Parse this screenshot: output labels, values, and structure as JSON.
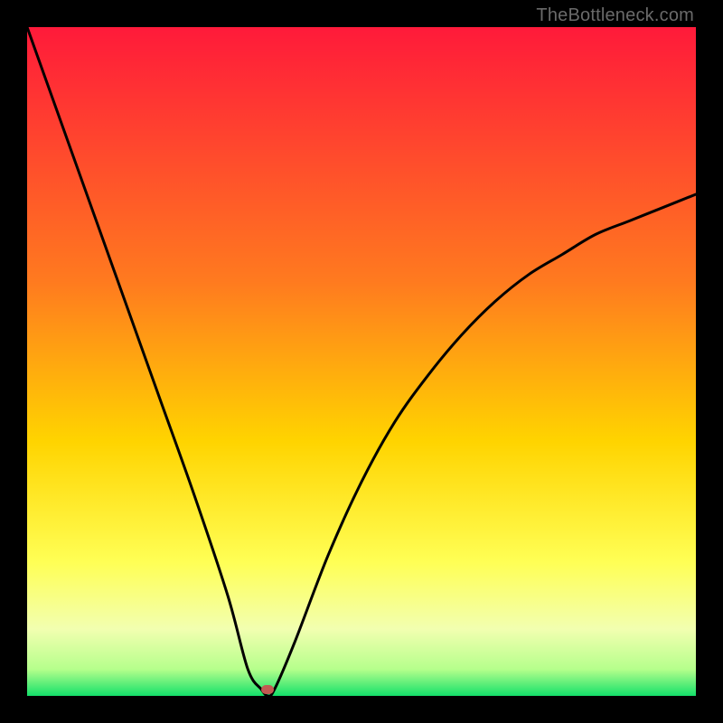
{
  "watermark": "TheBottleneck.com",
  "colors": {
    "frame": "#000000",
    "top": "#ff1a3a",
    "mid_upper": "#ff7a1f",
    "mid": "#ffd400",
    "mid_lower": "#ffff66",
    "pale": "#e9ffb3",
    "bottom": "#14e06a",
    "curve": "#000000",
    "marker": "#c25a52"
  },
  "chart_data": {
    "type": "line",
    "title": "",
    "xlabel": "",
    "ylabel": "",
    "xlim": [
      0,
      100
    ],
    "ylim": [
      0,
      100
    ],
    "annotations": [
      {
        "text": "TheBottleneck.com",
        "pos": "top-right"
      }
    ],
    "series": [
      {
        "name": "bottleneck-curve",
        "x": [
          0,
          5,
          10,
          15,
          20,
          25,
          30,
          33,
          35,
          36,
          37,
          40,
          45,
          50,
          55,
          60,
          65,
          70,
          75,
          80,
          85,
          90,
          95,
          100
        ],
        "y": [
          100,
          86,
          72,
          58,
          44,
          30,
          15,
          4,
          1,
          0,
          1,
          8,
          21,
          32,
          41,
          48,
          54,
          59,
          63,
          66,
          69,
          71,
          73,
          75
        ]
      }
    ],
    "markers": [
      {
        "name": "optimal-point",
        "x": 36,
        "y": 1
      }
    ],
    "gradient_stops": [
      {
        "pct": 0,
        "color": "#ff1a3a"
      },
      {
        "pct": 38,
        "color": "#ff7a1f"
      },
      {
        "pct": 62,
        "color": "#ffd400"
      },
      {
        "pct": 80,
        "color": "#ffff55"
      },
      {
        "pct": 90,
        "color": "#f2ffb0"
      },
      {
        "pct": 96,
        "color": "#b6ff8c"
      },
      {
        "pct": 100,
        "color": "#14e06a"
      }
    ]
  }
}
